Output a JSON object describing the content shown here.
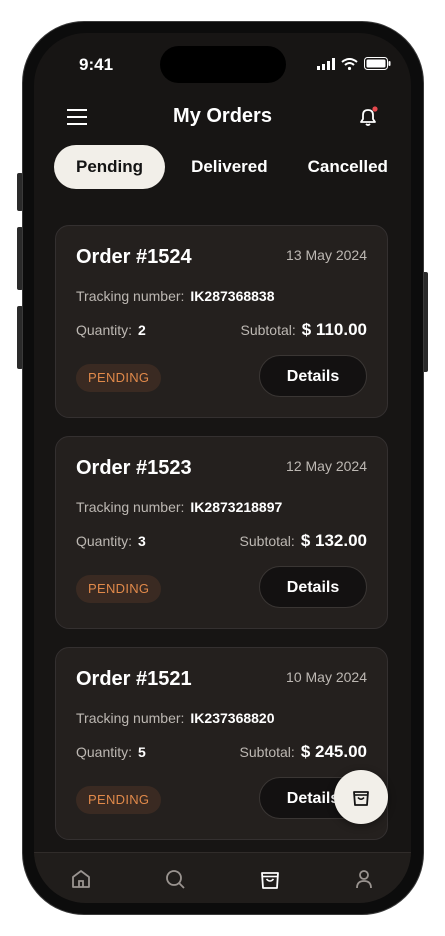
{
  "status": {
    "time": "9:41"
  },
  "header": {
    "title": "My Orders"
  },
  "tabs": [
    "Pending",
    "Delivered",
    "Cancelled"
  ],
  "orders": [
    {
      "id": "Order #1524",
      "date": "13 May 2024",
      "tracking_label": "Tracking number:",
      "tracking": "IK287368838",
      "qty_label": "Quantity:",
      "qty": "2",
      "subtotal_label": "Subtotal:",
      "subtotal": "$ 110.00",
      "status": "PENDING",
      "button": "Details"
    },
    {
      "id": "Order #1523",
      "date": "12 May 2024",
      "tracking_label": "Tracking number:",
      "tracking": "IK2873218897",
      "qty_label": "Quantity:",
      "qty": "3",
      "subtotal_label": "Subtotal:",
      "subtotal": "$ 132.00",
      "status": "PENDING",
      "button": "Details"
    },
    {
      "id": "Order #1521",
      "date": "10 May 2024",
      "tracking_label": "Tracking number:",
      "tracking": "IK237368820",
      "qty_label": "Quantity:",
      "qty": "5",
      "subtotal_label": "Subtotal:",
      "subtotal": "$ 245.00",
      "status": "PENDING",
      "button": "Details"
    }
  ],
  "nav": [
    "home-icon",
    "search-icon",
    "bag-icon",
    "profile-icon"
  ],
  "colors": {
    "accent": "#e0894a",
    "notification_dot": "#e5484d"
  }
}
